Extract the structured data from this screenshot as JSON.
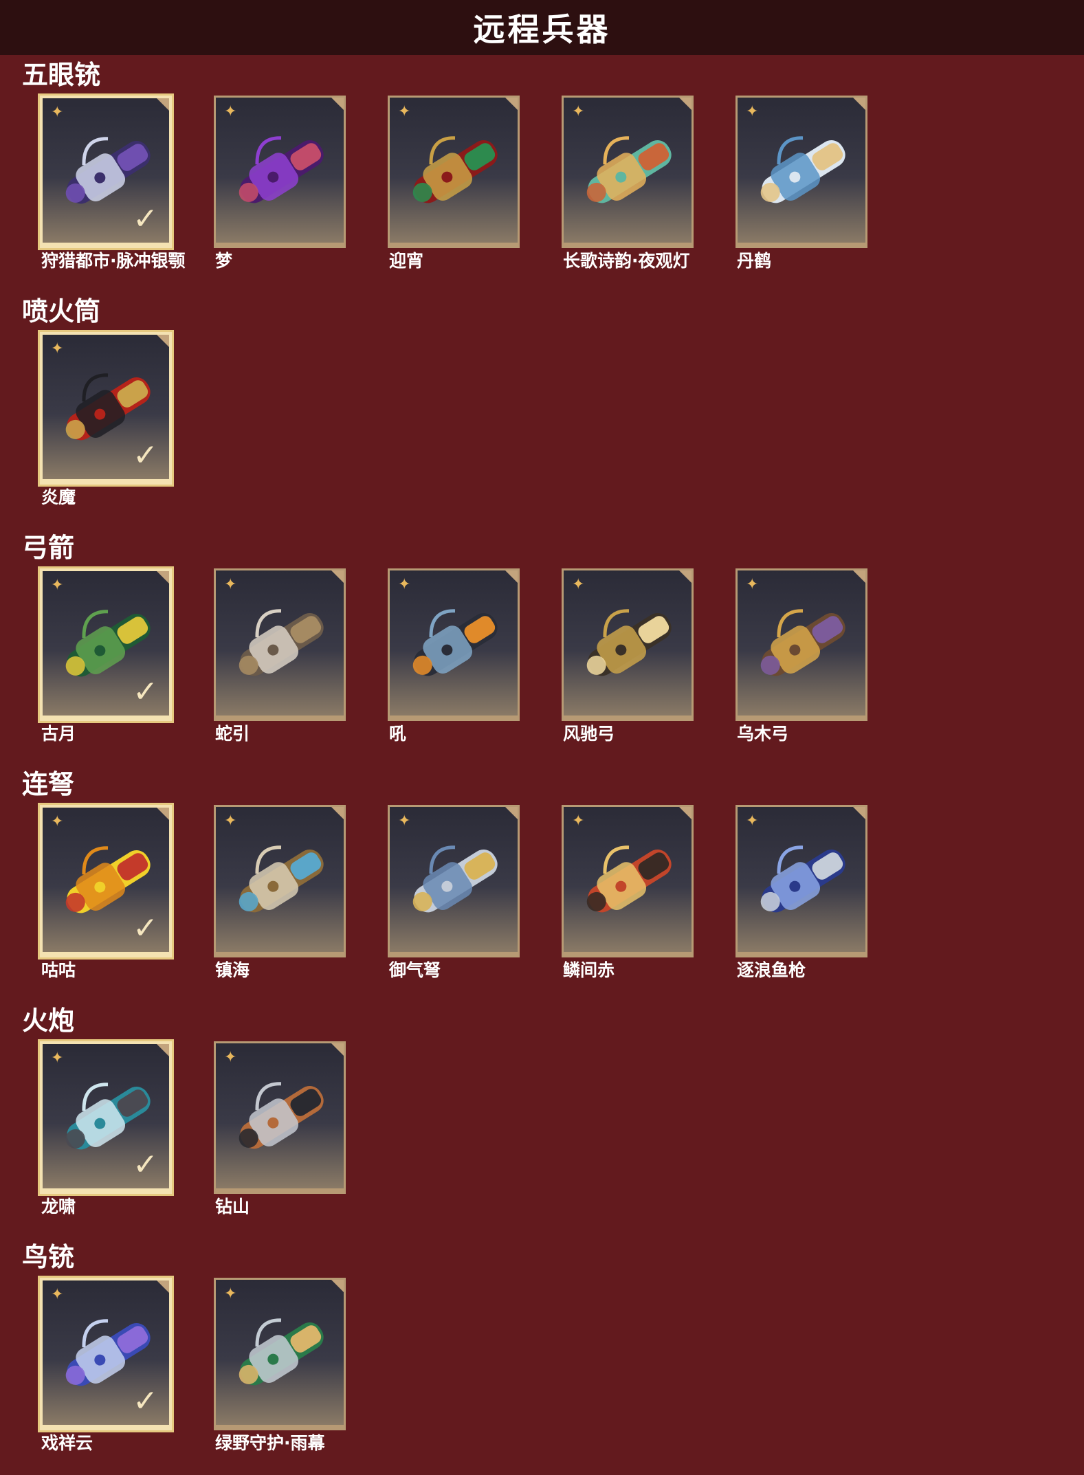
{
  "header": {
    "title": "远程兵器"
  },
  "colors": {
    "background": "#631a1e",
    "header_bg": "#2d0f10",
    "card_border": "#b79a74",
    "selected_border": "#f4e2b2",
    "accent_star": "#e9b85d"
  },
  "icons": {
    "star": "shuriken-star-icon",
    "check": "checkmark-icon"
  },
  "sections": [
    {
      "title": "五眼铳",
      "items": [
        {
          "name": "狩猎都市·脉冲银颚",
          "selected": true,
          "palette": [
            "#3b2f6b",
            "#cfd4ea",
            "#6f4fb0"
          ]
        },
        {
          "name": "梦",
          "selected": false,
          "palette": [
            "#4a1b6b",
            "#8e3fd0",
            "#c14b6a"
          ]
        },
        {
          "name": "迎宵",
          "selected": false,
          "palette": [
            "#8b1a1a",
            "#c9a045",
            "#2d8a4e"
          ]
        },
        {
          "name": "长歌诗韵·夜观灯",
          "selected": false,
          "palette": [
            "#5fb6a0",
            "#e6b25a",
            "#c9663a"
          ]
        },
        {
          "name": "丹鹤",
          "selected": false,
          "palette": [
            "#dce6f0",
            "#5c95c7",
            "#e3c58a"
          ]
        }
      ]
    },
    {
      "title": "喷火筒",
      "items": [
        {
          "name": "炎魔",
          "selected": true,
          "palette": [
            "#b4231a",
            "#1f1f24",
            "#caa24a"
          ]
        }
      ]
    },
    {
      "title": "弓箭",
      "items": [
        {
          "name": "古月",
          "selected": true,
          "palette": [
            "#1f5a35",
            "#5fa14f",
            "#d8c23a"
          ]
        },
        {
          "name": "蛇引",
          "selected": false,
          "palette": [
            "#6a5a4a",
            "#d8d0c4",
            "#a58a62"
          ]
        },
        {
          "name": "吼",
          "selected": false,
          "palette": [
            "#2a2d38",
            "#7fa4c4",
            "#e08a2a"
          ]
        },
        {
          "name": "风驰弓",
          "selected": false,
          "palette": [
            "#3a3128",
            "#c9a24a",
            "#e9d39a"
          ]
        },
        {
          "name": "乌木弓",
          "selected": false,
          "palette": [
            "#6b4a32",
            "#d6a64a",
            "#7c5b9a"
          ]
        }
      ]
    },
    {
      "title": "连弩",
      "items": [
        {
          "name": "咕咕",
          "selected": true,
          "palette": [
            "#f0d02a",
            "#e08a1a",
            "#c43a2a"
          ]
        },
        {
          "name": "镇海",
          "selected": false,
          "palette": [
            "#8a6a3a",
            "#d8ccb4",
            "#5aa6c9"
          ]
        },
        {
          "name": "御气弩",
          "selected": false,
          "palette": [
            "#c4ccd8",
            "#6a8ab4",
            "#d8b45a"
          ]
        },
        {
          "name": "鳞间赤",
          "selected": false,
          "palette": [
            "#c2452a",
            "#e9c26a",
            "#3a2a24"
          ]
        },
        {
          "name": "逐浪鱼枪",
          "selected": false,
          "palette": [
            "#2a3a8a",
            "#8aa4e4",
            "#c4ccd8"
          ]
        }
      ]
    },
    {
      "title": "火炮",
      "items": [
        {
          "name": "龙啸",
          "selected": true,
          "palette": [
            "#2a8a9a",
            "#cfe6ee",
            "#4a4a52"
          ]
        },
        {
          "name": "钻山",
          "selected": false,
          "palette": [
            "#b46a3a",
            "#c4c8d0",
            "#2a2a30"
          ]
        }
      ]
    },
    {
      "title": "鸟铳",
      "items": [
        {
          "name": "戏祥云",
          "selected": true,
          "palette": [
            "#3a4ab4",
            "#c4d0ee",
            "#8a6ad8"
          ]
        },
        {
          "name": "绿野守护·雨幕",
          "selected": false,
          "palette": [
            "#2a7a4a",
            "#c4ccd4",
            "#d8b46a"
          ]
        }
      ]
    }
  ]
}
